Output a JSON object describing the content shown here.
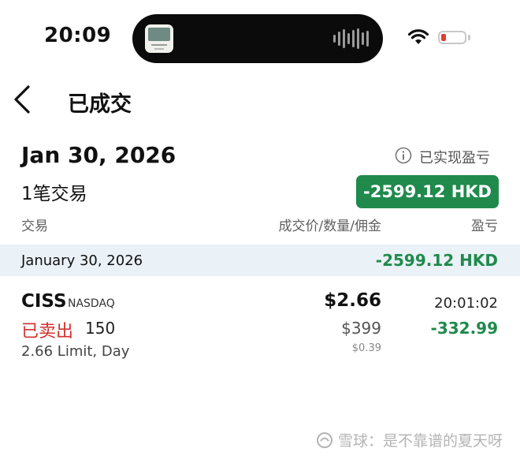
{
  "status_bar": {
    "time": "20:09",
    "icons": [
      "album-art",
      "audio-waveform-icon",
      "wifi-icon",
      "battery-low-icon"
    ],
    "battery_color": "#e63a2f"
  },
  "header": {
    "back_icon": "chevron-left-icon",
    "title": "已成交"
  },
  "summary": {
    "date": "Jan 30, 2026",
    "realized_label": "已实现盈亏",
    "trade_count": "1笔交易",
    "total_pl": "-2599.12 HKD",
    "badge_color": "#1f8a4c"
  },
  "columns": {
    "trade": "交易",
    "price_qty_comm": "成交价/数量/佣金",
    "pl": "盈亏"
  },
  "groups": [
    {
      "date": "January 30, 2026",
      "pl": "-2599.12 HKD",
      "trades": [
        {
          "symbol": "CISS",
          "exchange": "NASDAQ",
          "side": "已卖出",
          "quantity": "150",
          "order": "2.66 Limit, Day",
          "price": "$2.66",
          "amount": "$399",
          "commission": "$0.39",
          "time": "20:01:02",
          "pl": "-332.99"
        }
      ]
    }
  ],
  "colors": {
    "gain_loss_green": "#1f8a4c",
    "sell_red": "#d0312d"
  },
  "watermark": {
    "text": "雪球：是不靠谱的夏天呀"
  }
}
